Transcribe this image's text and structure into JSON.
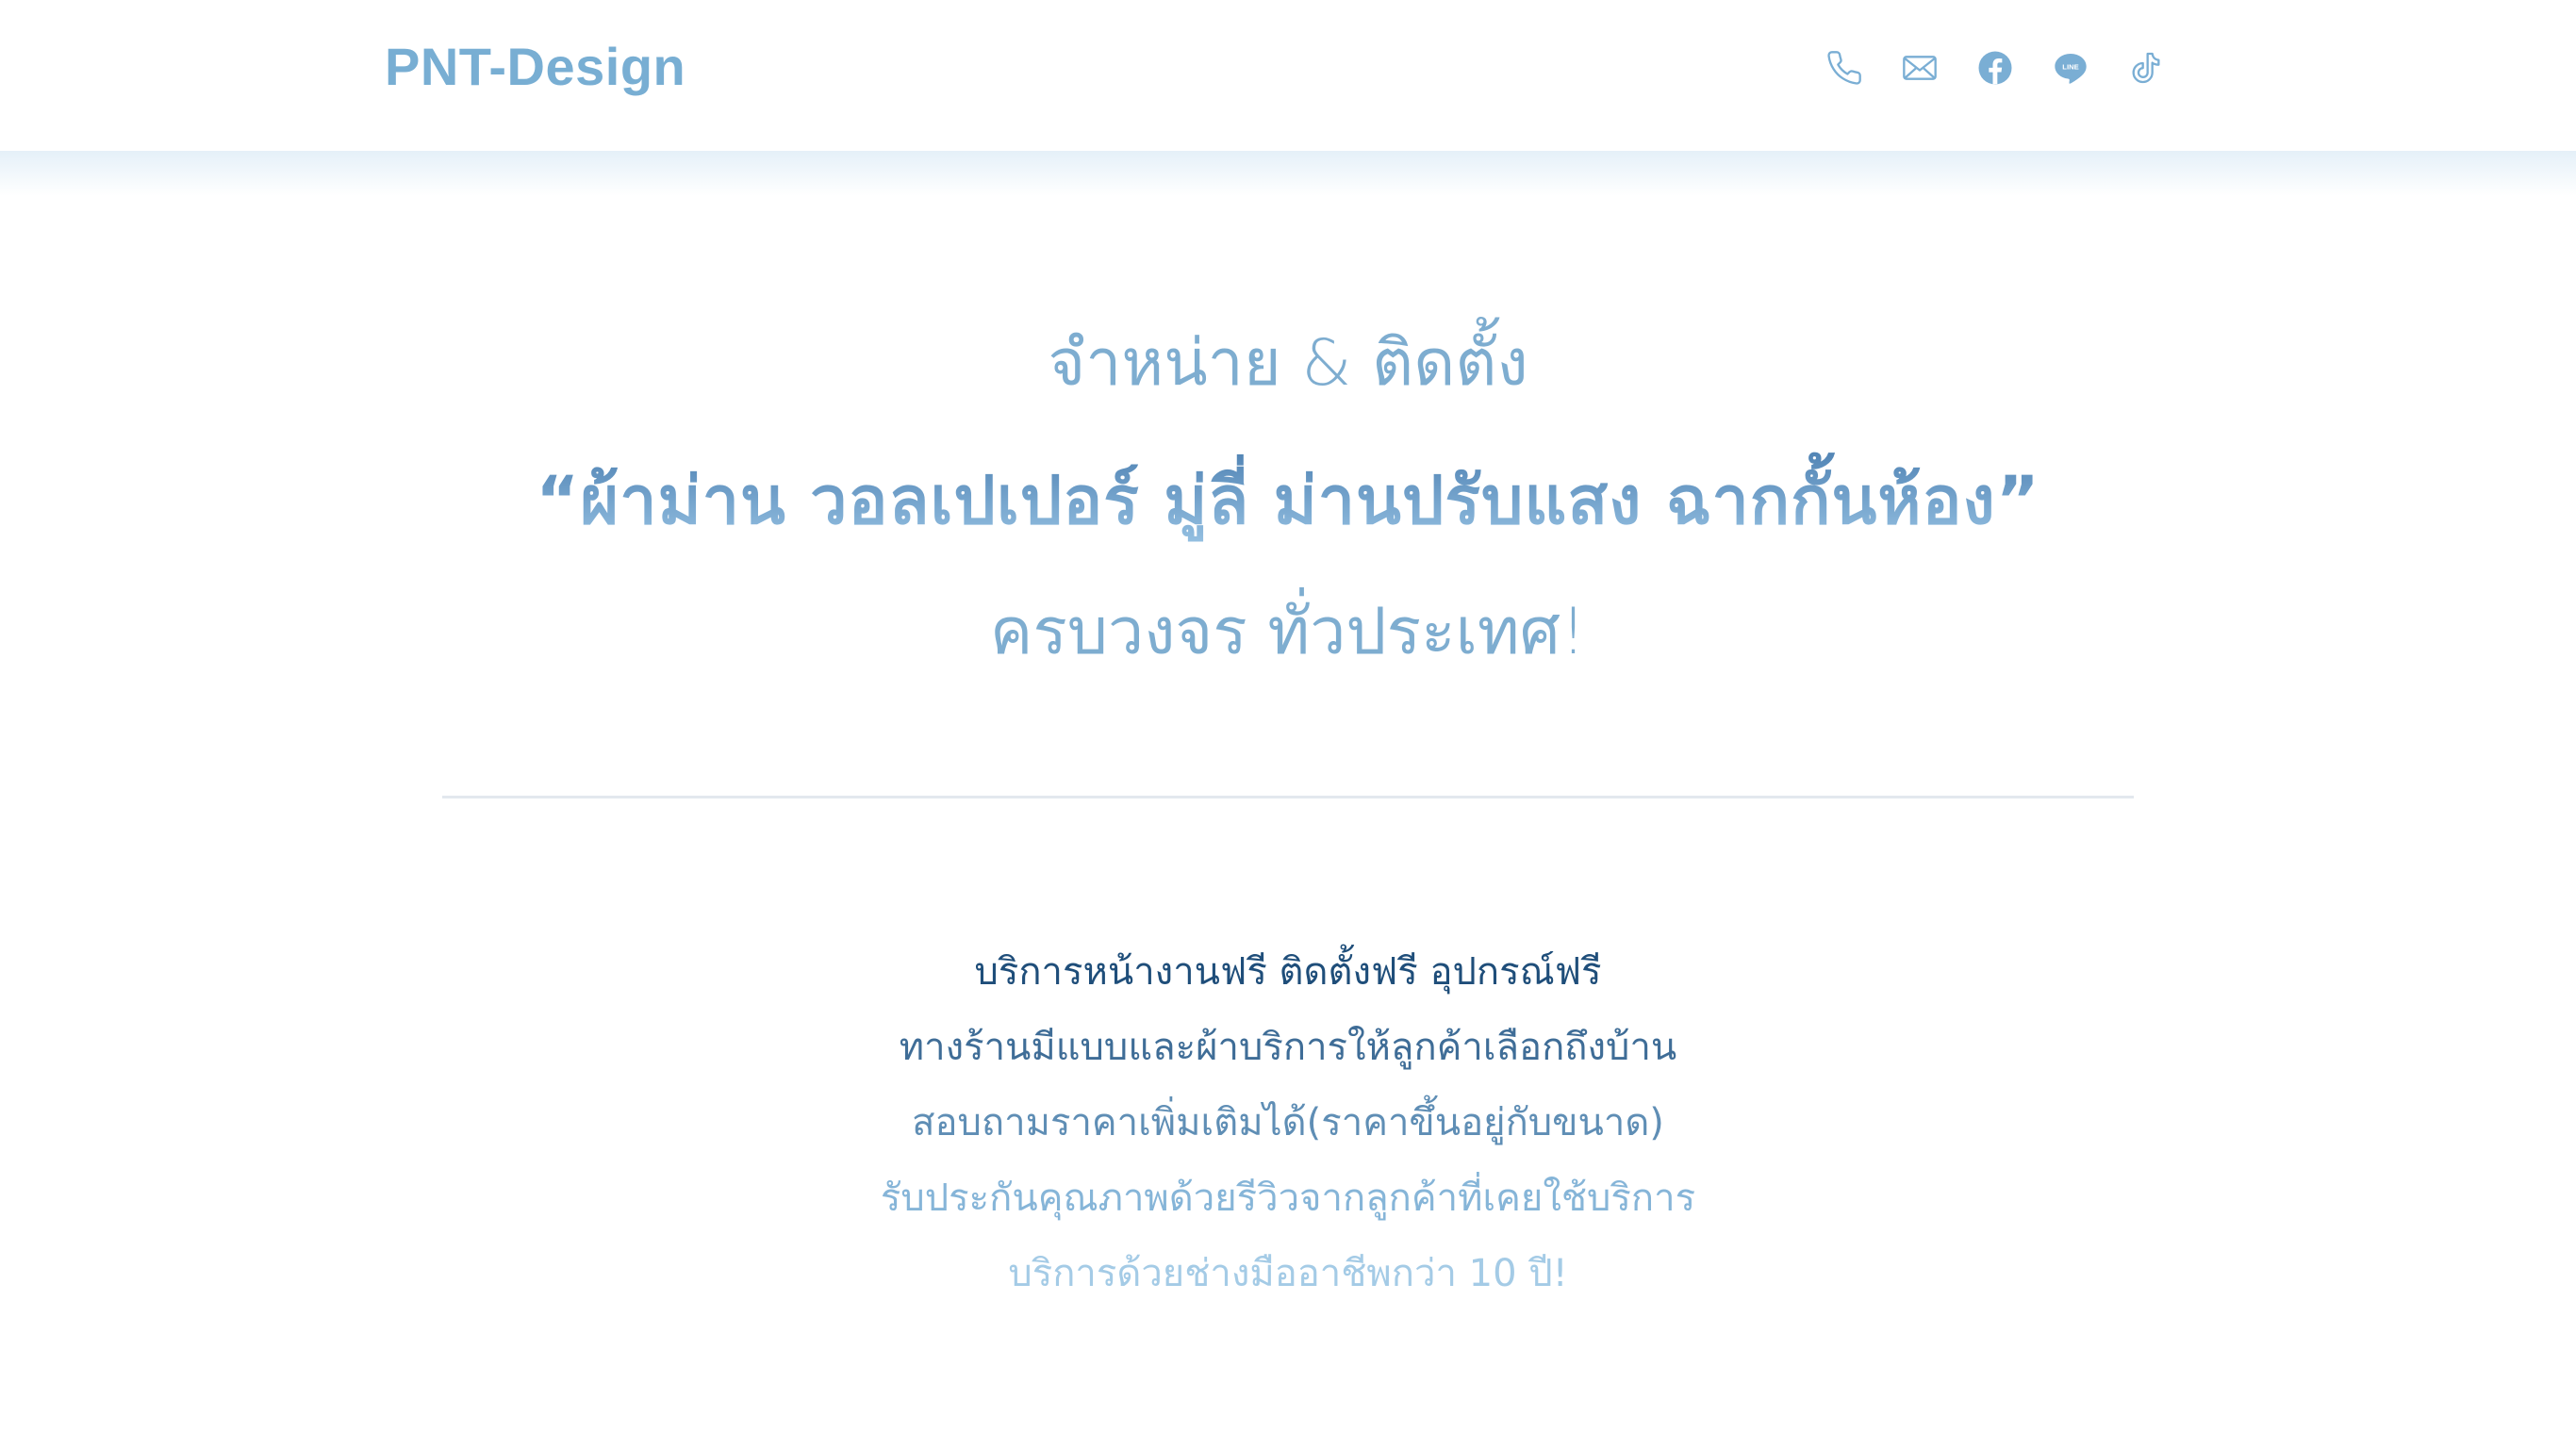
{
  "header": {
    "brand": "PNT-Design",
    "social": [
      {
        "icon": "phone-icon"
      },
      {
        "icon": "mail-icon"
      },
      {
        "icon": "facebook-icon"
      },
      {
        "icon": "line-icon",
        "label": "LINE"
      },
      {
        "icon": "tiktok-icon"
      }
    ]
  },
  "hero": {
    "line1": "จำหน่าย & ติดตั้ง",
    "line2": "“ผ้าม่าน วอลเปเปอร์ มู่ลี่ ม่านปรับแสง ฉากกั้นห้อง”",
    "line3": "ครบวงจร ทั่วประเทศ!"
  },
  "features": [
    "บริการหน้างานฟรี ติดตั้งฟรี อุปกรณ์ฟรี",
    "ทางร้านมีแบบและผ้าบริการให้ลูกค้าเลือกถึงบ้าน",
    "สอบถามราคาเพิ่มเติมได้(ราคาขึ้นอยู่กับขนาด)",
    "รับประกันคุณภาพด้วยรีวิวจากลูกค้าที่เคยใช้บริการ",
    "บริการด้วยช่างมืออาชีพกว่า 10 ปี!"
  ],
  "colors": {
    "brand": "#78aed3",
    "icon": "#7aaed4",
    "heading_dark": "#1f4e7a",
    "heading_light": "#a4cbe6",
    "divider": "#e3e8ee"
  }
}
